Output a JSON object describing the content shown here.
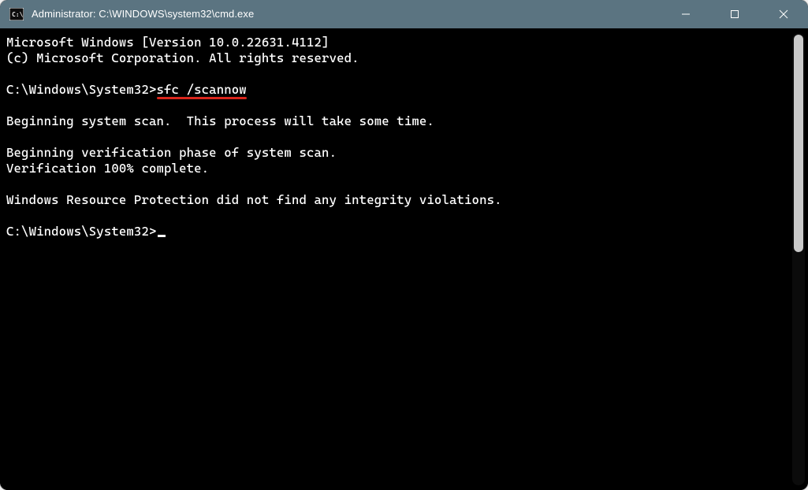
{
  "window": {
    "title": "Administrator: C:\\WINDOWS\\system32\\cmd.exe",
    "icon_name": "cmd-icon"
  },
  "controls": {
    "minimize": "Minimize",
    "maximize": "Maximize",
    "close": "Close"
  },
  "terminal": {
    "lines": [
      "Microsoft Windows [Version 10.0.22631.4112]",
      "(c) Microsoft Corporation. All rights reserved.",
      "",
      {
        "prompt": "C:\\Windows\\System32>",
        "command": "sfc /scannow",
        "highlight": true
      },
      "",
      "Beginning system scan.  This process will take some time.",
      "",
      "Beginning verification phase of system scan.",
      "Verification 100% complete.",
      "",
      "Windows Resource Protection did not find any integrity violations.",
      "",
      {
        "prompt": "C:\\Windows\\System32>",
        "cursor": true
      }
    ]
  }
}
